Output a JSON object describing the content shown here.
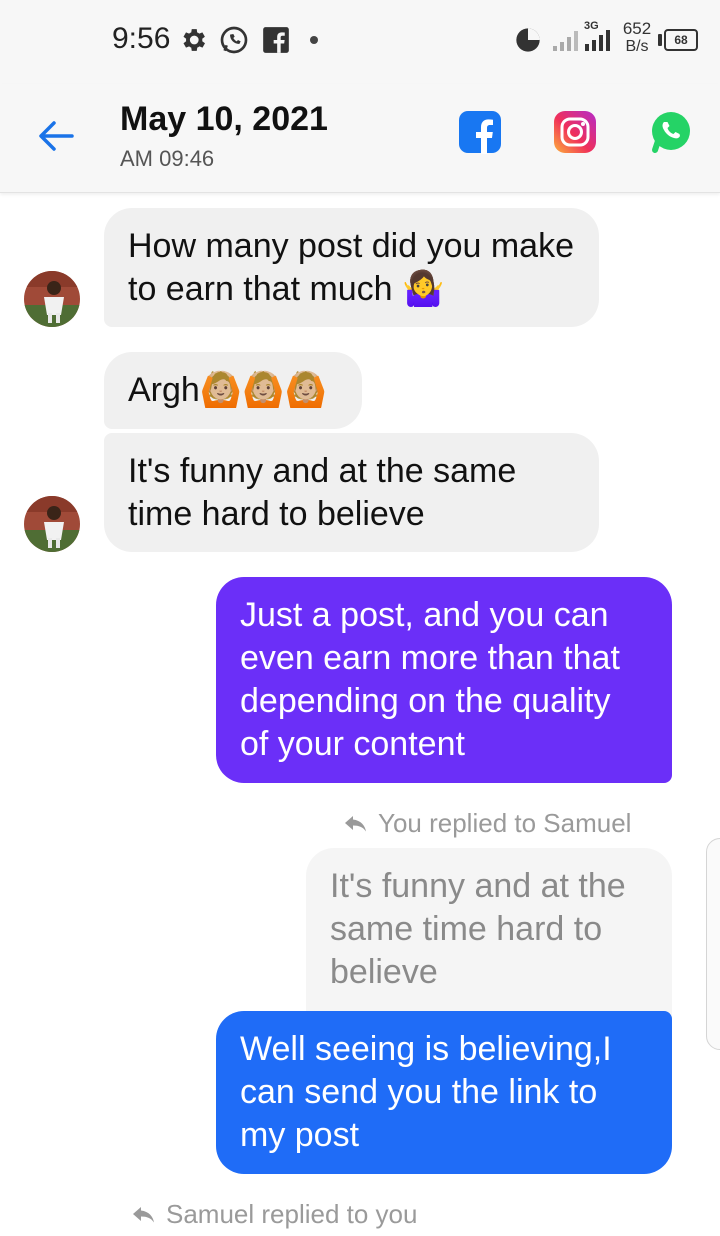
{
  "status_bar": {
    "time": "9:56",
    "network_type": "3G",
    "speed_value": "652",
    "speed_unit": "B/s",
    "battery": "68"
  },
  "header": {
    "date": "May 10, 2021",
    "time": "AM 09:46",
    "social_icons": [
      "facebook-icon",
      "instagram-icon",
      "whatsapp-icon"
    ]
  },
  "messages": {
    "m1": "How many post did you make to earn that much 🤷‍♀️",
    "m2": "Argh🙆🏼🙆🏼🙆🏼",
    "m3": "It's funny and at the same time hard to believe",
    "m4": "Just a post, and you can even earn more than that depending on the quality of your content",
    "reply_label_1": "You replied to Samuel",
    "quoted": "It's funny and at the same time hard to believe",
    "m5": "Well seeing is believing,I can send you the link to my post",
    "reply_label_2": "Samuel replied to you"
  },
  "colors": {
    "outgoing_purple": "#6b2ff8",
    "outgoing_blue": "#1f6cf7",
    "incoming_bg": "#f0f0f0",
    "back_arrow": "#1a73e8",
    "facebook": "#1877f2",
    "whatsapp": "#25d366"
  }
}
